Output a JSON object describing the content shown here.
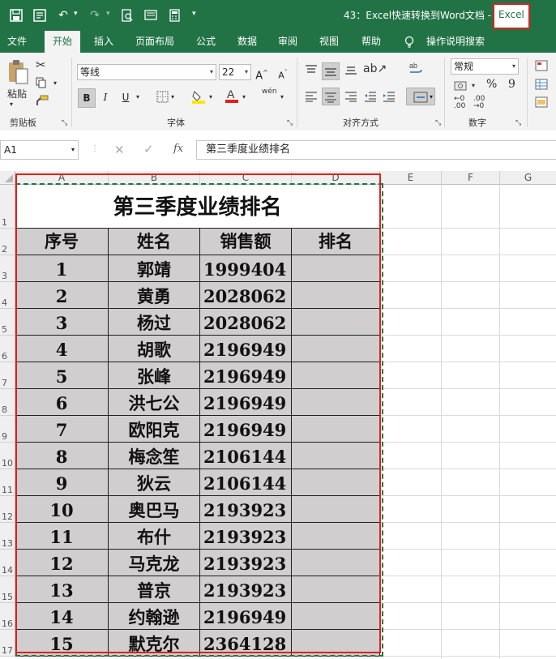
{
  "quick_access": {
    "save_icon": "save-icon",
    "form_icon": "form-icon",
    "undo_icon": "undo-icon",
    "redo_icon": "redo-icon",
    "preview_icon": "print-preview-icon",
    "screen_icon": "screen-icon",
    "calc_icon": "calculator-icon"
  },
  "title": {
    "document": "43：Excel快速转换到Word文档  -",
    "app": "Excel"
  },
  "tabs": [
    "文件",
    "开始",
    "插入",
    "页面布局",
    "公式",
    "数据",
    "审阅",
    "视图",
    "帮助",
    "操作说明搜索"
  ],
  "ribbon": {
    "clipboard": {
      "paste_label": "粘贴",
      "group_label": "剪贴板"
    },
    "font": {
      "name": "等线",
      "size": "22",
      "bold": "B",
      "italic": "I",
      "underline": "U",
      "group_label": "字体",
      "wen_label": "wén",
      "grow": "A",
      "shrink": "A"
    },
    "alignment": {
      "group_label": "对齐方式"
    },
    "number": {
      "format": "常规",
      "percent": "%",
      "comma": "9",
      "group_label": "数字"
    }
  },
  "formula_bar": {
    "name_box": "A1",
    "fx_label": "fx",
    "content": "第三季度业绩排名"
  },
  "columns": [
    "A",
    "B",
    "C",
    "D",
    "E",
    "F",
    "G"
  ],
  "rows": [
    "1",
    "2",
    "3",
    "4",
    "5",
    "6",
    "7",
    "8",
    "9",
    "10",
    "11",
    "12",
    "13",
    "14",
    "15",
    "16",
    "17"
  ],
  "sheet": {
    "title": "第三季度业绩排名",
    "headers": [
      "序号",
      "姓名",
      "销售额",
      "排名"
    ],
    "records": [
      [
        "1",
        "郭靖",
        "1999404",
        ""
      ],
      [
        "2",
        "黄勇",
        "2028062",
        ""
      ],
      [
        "3",
        "杨过",
        "2028062",
        ""
      ],
      [
        "4",
        "胡歌",
        "2196949",
        ""
      ],
      [
        "5",
        "张峰",
        "2196949",
        ""
      ],
      [
        "6",
        "洪七公",
        "2196949",
        ""
      ],
      [
        "7",
        "欧阳克",
        "2196949",
        ""
      ],
      [
        "8",
        "梅念笙",
        "2106144",
        ""
      ],
      [
        "9",
        "狄云",
        "2106144",
        ""
      ],
      [
        "10",
        "奥巴马",
        "2193923",
        ""
      ],
      [
        "11",
        "布什",
        "2193923",
        ""
      ],
      [
        "12",
        "马克龙",
        "2193923",
        ""
      ],
      [
        "13",
        "普京",
        "2193923",
        ""
      ],
      [
        "14",
        "约翰逊",
        "2196949",
        ""
      ],
      [
        "15",
        "默克尔",
        "2364128",
        ""
      ]
    ]
  },
  "colors": {
    "excel_green": "#217346",
    "highlight_red": "#e0201c",
    "cell_fill": "#d0cece",
    "copy_marquee": "#217346"
  }
}
